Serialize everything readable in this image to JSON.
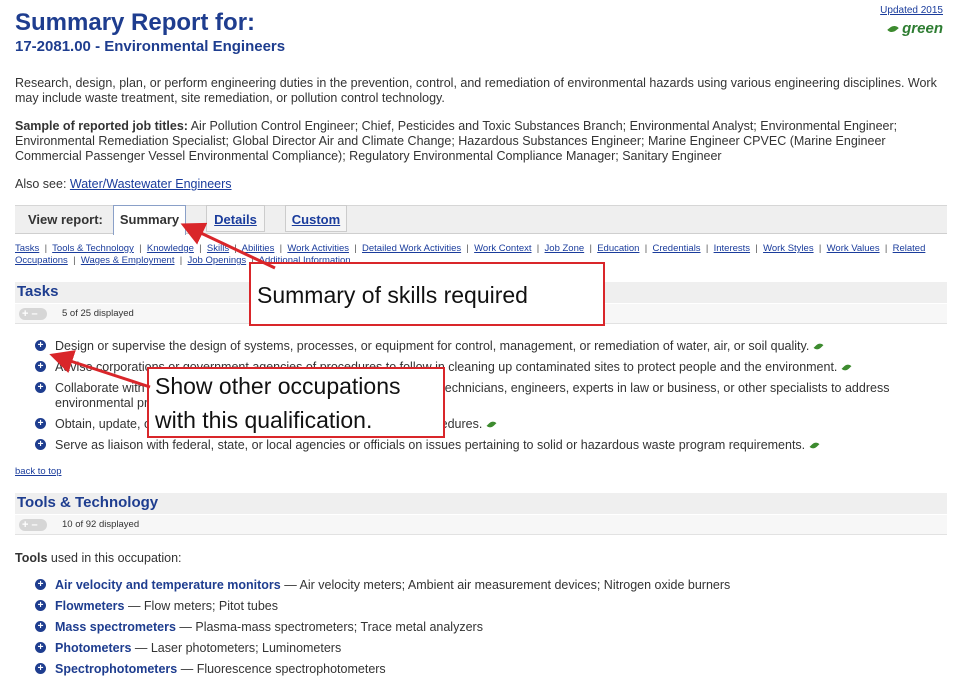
{
  "header": {
    "title": "Summary Report for:",
    "subtitle": "17-2081.00 - Environmental Engineers",
    "updated": "Updated 2015",
    "green_badge": "green"
  },
  "description": "Research, design, plan, or perform engineering duties in the prevention, control, and remediation of environmental hazards using various engineering disciplines. Work may include waste treatment, site remediation, or pollution control technology.",
  "sample": {
    "label": "Sample of reported job titles:",
    "titles": " Air Pollution Control Engineer; Chief, Pesticides and Toxic Substances Branch; Environmental Analyst; Environmental Engineer; Environmental Remediation Specialist; Global Director Air and Climate Change; Hazardous Substances Engineer; Marine Engineer CPVEC (Marine Engineer Commercial Passenger Vessel Environmental Compliance); Regulatory Environmental Compliance Manager; Sanitary Engineer"
  },
  "also_see": {
    "label": "Also see: ",
    "link": "Water/Wastewater Engineers"
  },
  "view_report": {
    "label": "View report:",
    "tabs": [
      "Summary",
      "Details",
      "Custom"
    ]
  },
  "quick_links": [
    "Tasks",
    "Tools & Technology",
    "Knowledge",
    "Skills",
    "Abilities",
    "Work Activities",
    "Detailed Work Activities",
    "Work Context",
    "Job Zone",
    "Education",
    "Credentials",
    "Interests",
    "Work Styles",
    "Work Values",
    "Related Occupations",
    "Wages & Employment",
    "Job Openings",
    "Additional Information"
  ],
  "tasks": {
    "title": "Tasks",
    "count": "5 of 25 displayed",
    "items": [
      "Design or supervise the design of systems, processes, or equipment for control, management, or remediation of water, air, or soil quality.",
      "Advise corporations or government agencies of procedures to follow in cleaning up contaminated sites to protect people and the environment.",
      "Collaborate with environmental scientists, planners, hazardous waste technicians, engineers, experts in law or business, or other specialists to address environmental problems.",
      "Obtain, update, or maintain plans, permits, or standard operating procedures.",
      "Serve as liaison with federal, state, or local agencies or officials on issues pertaining to solid or hazardous waste program requirements."
    ]
  },
  "back_to_top": "back to top",
  "tools": {
    "title": "Tools & Technology",
    "count": "10 of 92 displayed",
    "intro_bold": "Tools",
    "intro_rest": " used in this occupation:",
    "items": [
      {
        "name": "Air velocity and temperature monitors",
        "examples": " — Air velocity meters; Ambient air measurement devices; Nitrogen oxide burners"
      },
      {
        "name": "Flowmeters",
        "examples": " — Flow meters; Pitot tubes"
      },
      {
        "name": "Mass spectrometers",
        "examples": " — Plasma-mass spectrometers; Trace metal analyzers"
      },
      {
        "name": "Photometers",
        "examples": " — Laser photometers; Luminometers"
      },
      {
        "name": "Spectrophotometers",
        "examples": " — Fluorescence spectrophotometers"
      }
    ]
  },
  "annotations": {
    "callout1": "Summary of skills required",
    "callout2_line1": "Show other occupations",
    "callout2_line2": "with this qualification."
  },
  "colors": {
    "heading": "#1e3d8f",
    "annotation": "#d9262a",
    "green": "#3d8b2f"
  }
}
